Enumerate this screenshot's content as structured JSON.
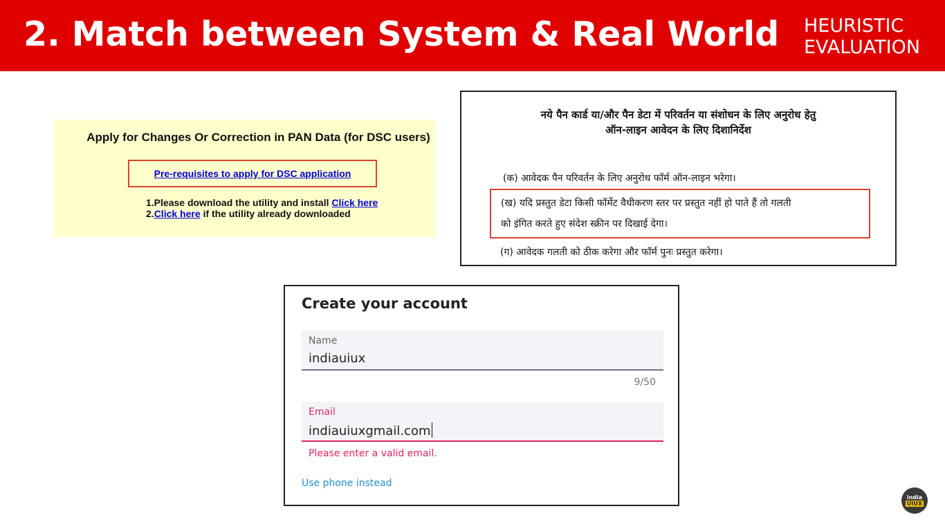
{
  "slide": {
    "title": "2. Match between System & Real World",
    "tag_line1": "HEURISTIC",
    "tag_line2": "EVALUATION"
  },
  "pan": {
    "title": "Apply for Changes Or Correction in PAN Data (for DSC users)",
    "prereq_link": "Pre-requisites to apply for DSC application",
    "step1_text": "1.Please download the utility and install ",
    "step1_link": "Click here",
    "step2_prefix": "2.",
    "step2_link": "Click here",
    "step2_text": " if the utility already downloaded"
  },
  "hindi": {
    "title_line1": "नये पैन कार्ड या/और पैन डेटा में परिवर्तन या संशोधन के लिए अनुरोध हेतु",
    "title_line2": "ऑन-लाइन आवेदन के लिए दिशानिर्देश",
    "item_ka": "(क) आवेदक पैन परिवर्तन के लिए अनुरोध फॉर्म ऑन-लाइन भरेगा।",
    "item_kha_line1": "(ख) यदि प्रस्तुत डेटा किसी फॉर्मेट वैधीकरण स्तर पर प्रस्तुत नहीं हो पाते हैं तो गलती",
    "item_kha_line2": "को इंगित करते हुए संदेश स्क्रीन पर दिखाई देगा।",
    "item_ga": "(ग) आवेदक गलती को ठीक करेगा और फॉर्म पुनः प्रस्तुत करेगा।"
  },
  "account": {
    "title": "Create your account",
    "name_label": "Name",
    "name_value": "indiauiux",
    "name_counter": "9/50",
    "email_label": "Email",
    "email_value": "indiauiuxgmail.com",
    "email_error": "Please enter a valid email.",
    "phone_link": "Use phone instead"
  },
  "logo": {
    "line1": "india",
    "line2": "UIUX"
  },
  "colors": {
    "header_red": "#e00000",
    "highlight_border": "#d8442a",
    "error_pink": "#e0245e",
    "pan_bg": "#ffffcc"
  }
}
